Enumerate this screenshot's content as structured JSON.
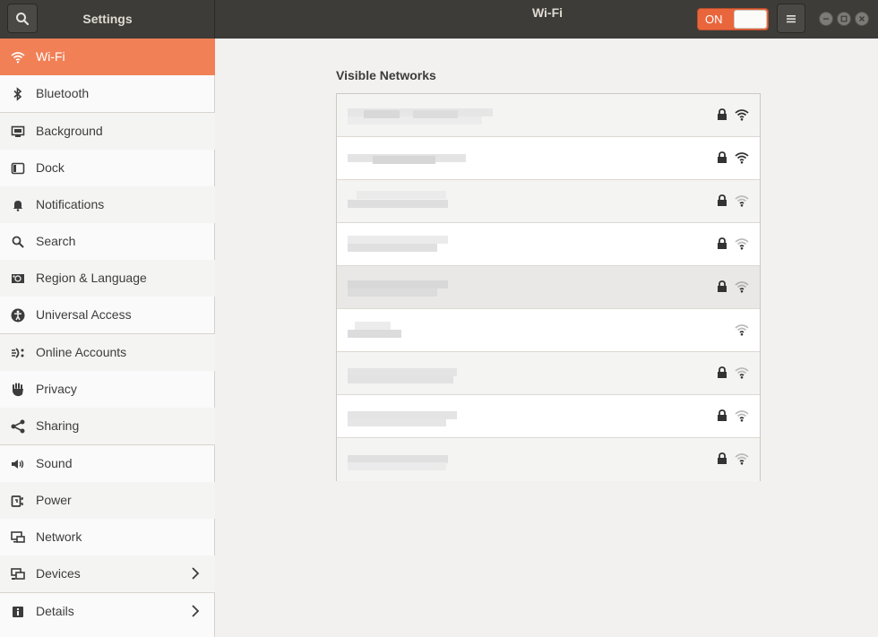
{
  "header": {
    "app_title": "Settings",
    "page_title": "Wi-Fi",
    "wifi_switch": {
      "label": "ON",
      "state": "on"
    },
    "accent_color": "#e9663c"
  },
  "sidebar": {
    "items": [
      {
        "label": "Wi-Fi",
        "icon": "wifi-icon",
        "active": true
      },
      {
        "label": "Bluetooth",
        "icon": "bluetooth-icon"
      },
      {
        "label": "Background",
        "icon": "background-icon"
      },
      {
        "label": "Dock",
        "icon": "dock-icon"
      },
      {
        "label": "Notifications",
        "icon": "bell-icon"
      },
      {
        "label": "Search",
        "icon": "search-icon"
      },
      {
        "label": "Region & Language",
        "icon": "region-icon"
      },
      {
        "label": "Universal Access",
        "icon": "accessibility-icon"
      },
      {
        "label": "Online Accounts",
        "icon": "online-accounts-icon"
      },
      {
        "label": "Privacy",
        "icon": "hand-icon"
      },
      {
        "label": "Sharing",
        "icon": "share-icon"
      },
      {
        "label": "Sound",
        "icon": "speaker-icon"
      },
      {
        "label": "Power",
        "icon": "power-icon"
      },
      {
        "label": "Network",
        "icon": "network-icon"
      },
      {
        "label": "Devices",
        "icon": "devices-icon",
        "has_submenu": true
      },
      {
        "label": "Details",
        "icon": "info-icon",
        "has_submenu": true
      }
    ],
    "active_color": "#f18057"
  },
  "main": {
    "section_title": "Visible Networks",
    "networks": [
      {
        "name_obscured": true,
        "secured": true,
        "signal": "strong"
      },
      {
        "name_obscured": true,
        "secured": true,
        "signal": "strong"
      },
      {
        "name_obscured": true,
        "secured": true,
        "signal": "weak"
      },
      {
        "name_obscured": true,
        "secured": true,
        "signal": "weak"
      },
      {
        "name_obscured": true,
        "secured": true,
        "signal": "weak",
        "highlighted": true
      },
      {
        "name_obscured": true,
        "secured": false,
        "signal": "weak"
      },
      {
        "name_obscured": true,
        "secured": true,
        "signal": "weak"
      },
      {
        "name_obscured": true,
        "secured": true,
        "signal": "weak"
      },
      {
        "name_obscured": true,
        "secured": true,
        "signal": "weak"
      }
    ]
  }
}
